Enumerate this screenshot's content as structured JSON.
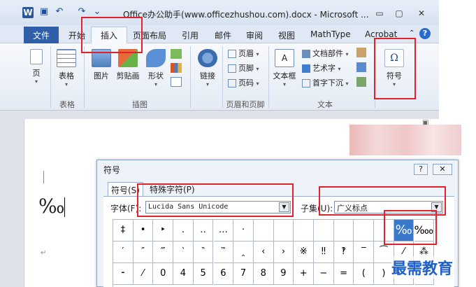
{
  "window": {
    "title": "Office办公助手(www.officezhushou.com).docx - Microsoft ...",
    "minimize": "▭",
    "restore": "▢",
    "close": "✕",
    "app_icon": "W"
  },
  "ribbon_tabs": [
    "文件",
    "开始",
    "插入",
    "页面布局",
    "引用",
    "邮件",
    "审阅",
    "视图",
    "MathType",
    "Acrobat"
  ],
  "ribbon": {
    "pages": "页",
    "table": "表格",
    "picture": "图片",
    "clipart": "剪贴画",
    "shapes": "形状",
    "link": "链接",
    "header": "页眉",
    "footer": "页脚",
    "page_number": "页码",
    "textbox": "文本框",
    "doc_parts": "文档部件",
    "wordart": "艺术字",
    "dropcap": "首字下沉",
    "symbol": "符号",
    "symbol_glyph": "Ω",
    "groups": {
      "table": "表格",
      "illustrations": "插图",
      "header_footer": "页眉和页脚",
      "text": "文本"
    }
  },
  "document": {
    "content": "‰"
  },
  "dialog": {
    "title": "符号",
    "help": "?",
    "close": "✕",
    "tabs": [
      "符号(S)",
      "特殊字符(P)"
    ],
    "font_label": "字体(F):",
    "font_value": "Lucida Sans Unicode",
    "subset_label": "子集(U):",
    "subset_value": "广义标点",
    "grid_rows": [
      [
        "‡",
        "•",
        "‣",
        "․",
        "‥",
        "…",
        "‧",
        "",
        "",
        "",
        "",
        "",
        "",
        "",
        "‰",
        "‱"
      ],
      [
        "′",
        "″",
        "‴",
        "‵",
        "‶",
        "‷",
        "‸",
        "‹",
        "›",
        "※",
        "‼",
        "‽",
        "‾",
        "⁀",
        "⁄",
        "⁂"
      ],
      [
        "⁃",
        "⁄",
        "0",
        "4",
        "5",
        "6",
        "7",
        "8",
        "9",
        "+",
        "−",
        "=",
        "(",
        ")",
        "",
        ""
      ]
    ]
  },
  "watermark": "最需教育"
}
